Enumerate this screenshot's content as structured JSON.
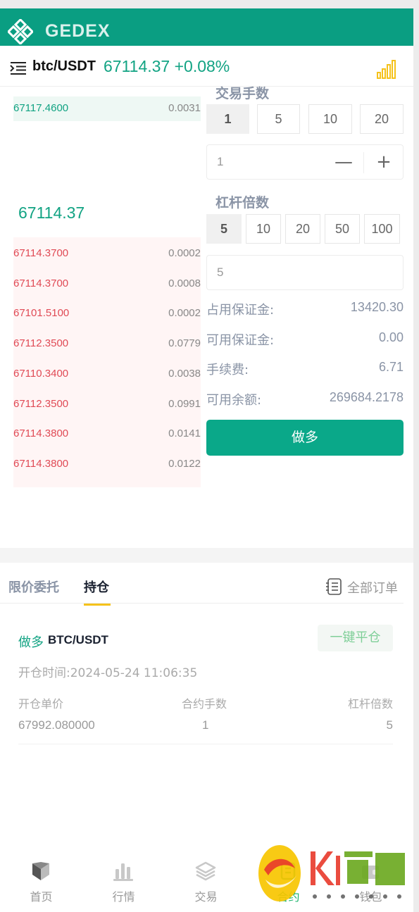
{
  "app": {
    "logo_text": "GEDEX"
  },
  "pair": {
    "name": "btc/USDT",
    "price_change": "67114.37 +0.08%"
  },
  "orderbook": {
    "asks": [
      {
        "price": "67117.4600",
        "amount": "0.0031"
      }
    ],
    "last_price": "67114.37",
    "bids": [
      {
        "price": "67114.3700",
        "amount": "0.0002"
      },
      {
        "price": "67114.3700",
        "amount": "0.0008"
      },
      {
        "price": "67101.5100",
        "amount": "0.0002"
      },
      {
        "price": "67112.3500",
        "amount": "0.0779"
      },
      {
        "price": "67110.3400",
        "amount": "0.0038"
      },
      {
        "price": "67112.3500",
        "amount": "0.0991"
      },
      {
        "price": "67114.3800",
        "amount": "0.0141"
      },
      {
        "price": "67114.3800",
        "amount": "0.0122"
      }
    ]
  },
  "trade_form": {
    "lots_label": "交易手数",
    "lots_options": [
      "1",
      "5",
      "10",
      "20"
    ],
    "lots_value": "1",
    "minus": "—",
    "plus": "+",
    "leverage_label": "杠杆倍数",
    "leverage_options": [
      "5",
      "10",
      "20",
      "50",
      "100"
    ],
    "leverage_value": "5",
    "margin_used_label": "占用保证金:",
    "margin_used_value": "13420.30",
    "margin_avail_label": "可用保证金:",
    "margin_avail_value": "0.00",
    "fee_label": "手续费:",
    "fee_value": "6.71",
    "balance_label": "可用余额:",
    "balance_value": "269684.2178",
    "submit_label": "做多"
  },
  "orders": {
    "tabs": [
      "限价委托",
      "持仓"
    ],
    "active_tab": "持仓",
    "all_orders_label": "全部订单",
    "position": {
      "side": "做多",
      "pair": "BTC/USDT",
      "close_label": "一键平仓",
      "open_time": "开仓时间:2024-05-24 11:06:35",
      "col_price_label": "开仓单价",
      "col_lots_label": "合约手数",
      "col_leverage_label": "杠杆倍数",
      "open_price": "67992.080000",
      "lots": "1",
      "leverage": "5"
    }
  },
  "nav": {
    "items": [
      {
        "label": "首页",
        "icon": "home-icon"
      },
      {
        "label": "行情",
        "icon": "market-icon"
      },
      {
        "label": "交易",
        "icon": "trade-icon"
      },
      {
        "label": "合约",
        "icon": "contract-icon"
      },
      {
        "label": "钱包",
        "icon": "wallet-icon"
      }
    ],
    "active": "合约"
  },
  "colors": {
    "brand": "#0a9e82",
    "up": "#12a383",
    "down": "#e04a55",
    "accent": "#f5c21b"
  }
}
